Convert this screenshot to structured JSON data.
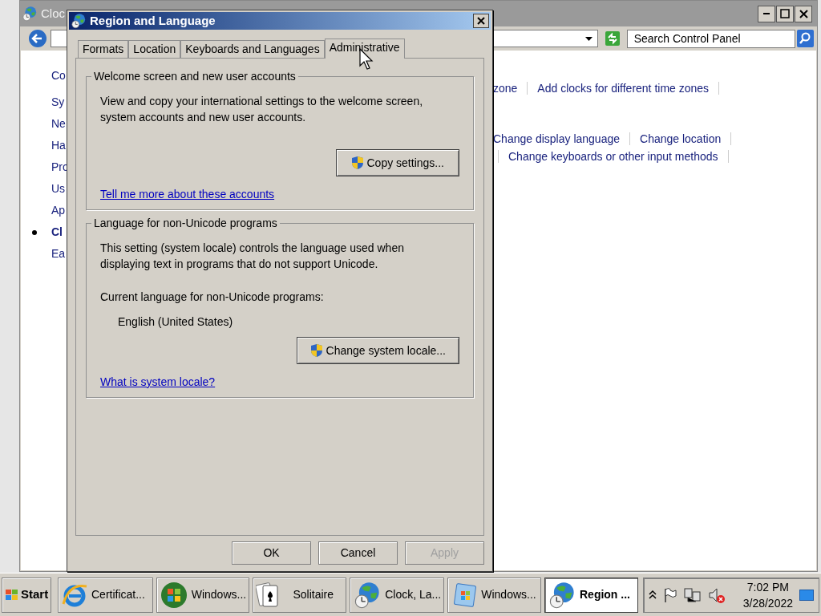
{
  "background_window": {
    "title": "Cloc",
    "search": {
      "placeholder": "Search Control Panel"
    },
    "sidebar": {
      "items": [
        {
          "label": "Co",
          "selected": false
        },
        {
          "label": "Sy",
          "selected": false
        },
        {
          "label": "Ne",
          "selected": false
        },
        {
          "label": "Ha",
          "selected": false
        },
        {
          "label": "Pro",
          "selected": false
        },
        {
          "label": "Us",
          "selected": false
        },
        {
          "label": "Ap",
          "selected": false
        },
        {
          "label": "Cl",
          "selected": true
        },
        {
          "label": "Ea",
          "selected": false
        }
      ]
    },
    "link_rows": [
      {
        "links": [
          "zone",
          "Add clocks for different time zones"
        ]
      },
      {
        "links": [
          "Change display language",
          "Change location"
        ]
      },
      {
        "links": [
          "Change keyboards or other input methods"
        ]
      }
    ]
  },
  "dialog": {
    "title": "Region and Language",
    "tabs": [
      {
        "label": "Formats",
        "selected": false
      },
      {
        "label": "Location",
        "selected": false
      },
      {
        "label": "Keyboards and Languages",
        "selected": false
      },
      {
        "label": "Administrative",
        "selected": true
      }
    ],
    "groups": [
      {
        "title": "Welcome screen and new user accounts",
        "text": "View and copy your international settings to the welcome screen, system accounts and new user accounts.",
        "button": "Copy settings...",
        "link": "Tell me more about these accounts"
      },
      {
        "title": "Language for non-Unicode programs",
        "text": "This setting (system locale) controls the language used when displaying text in programs that do not support Unicode.",
        "current_label": "Current language for non-Unicode programs:",
        "current_value": "English (United States)",
        "button": "Change system locale...",
        "link": "What is system locale?"
      }
    ],
    "buttons": [
      {
        "label": "OK",
        "disabled": false
      },
      {
        "label": "Cancel",
        "disabled": false
      },
      {
        "label": "Apply",
        "disabled": true
      }
    ]
  },
  "taskbar": {
    "start": "Start",
    "tasks": [
      {
        "label": "Certificat...",
        "kind": "browser",
        "selected": false
      },
      {
        "label": "Windows...",
        "kind": "orb",
        "selected": false
      },
      {
        "label": "Solitaire",
        "kind": "cards",
        "selected": false
      },
      {
        "label": "Clock, La...",
        "kind": "globe",
        "selected": false
      },
      {
        "label": "Windows...",
        "kind": "window",
        "selected": false
      },
      {
        "label": "Region ...",
        "kind": "globe",
        "selected": true
      }
    ],
    "clock": {
      "time": "7:02 PM",
      "date": "3/28/2022"
    }
  }
}
